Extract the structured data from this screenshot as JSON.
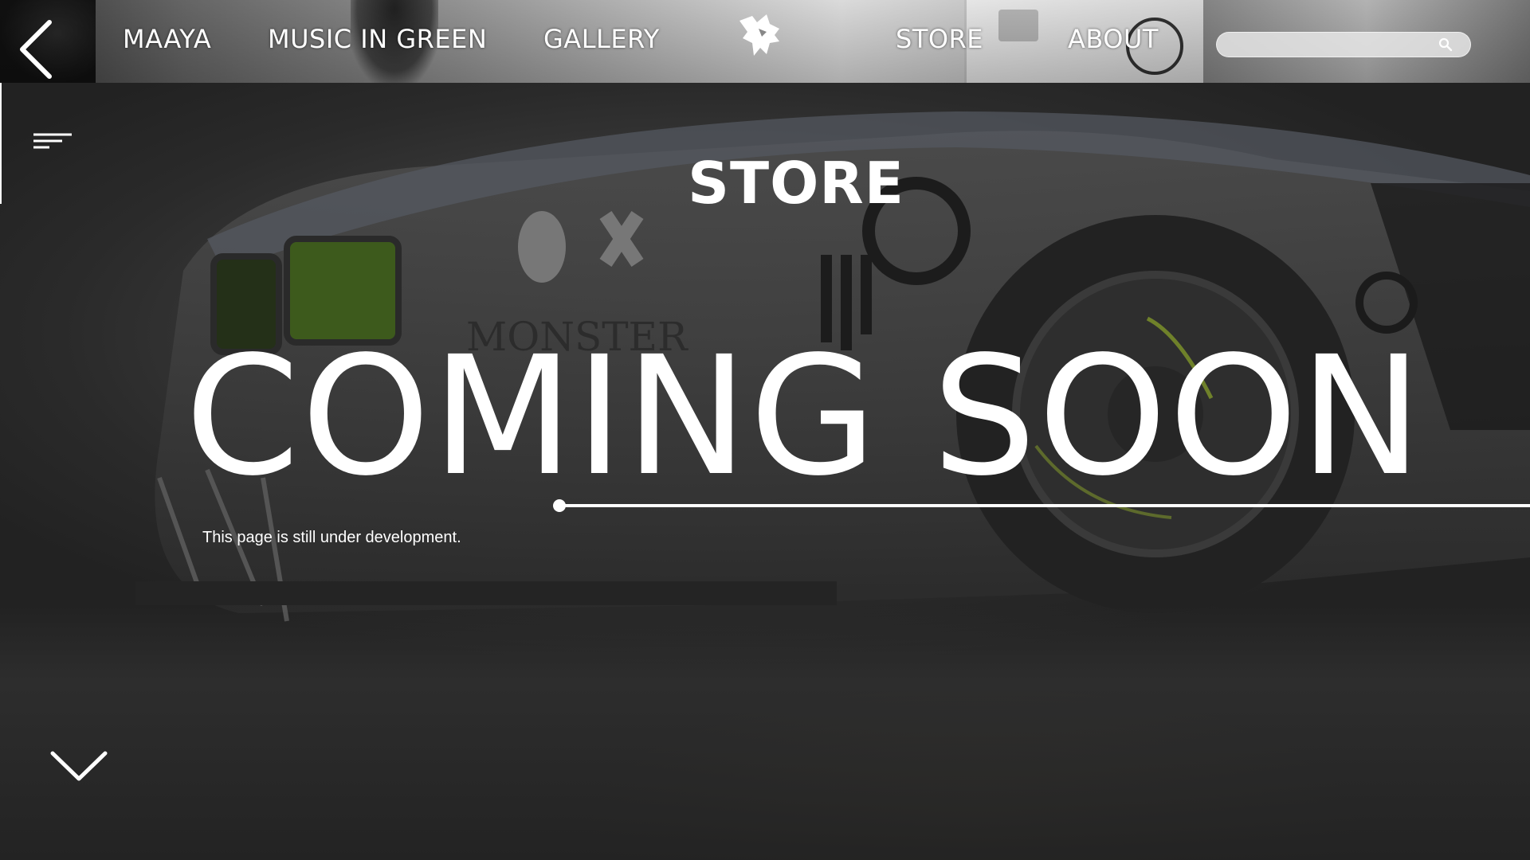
{
  "nav": {
    "items": [
      {
        "label": "MAAYA"
      },
      {
        "label": "MUSIC IN GREEN"
      },
      {
        "label": "GALLERY"
      },
      {
        "label": "STORE"
      },
      {
        "label": "ABOUT"
      }
    ],
    "logo_icon": "wolf-head-icon",
    "back_icon": "chevron-left-icon"
  },
  "search": {
    "value": "",
    "icon": "search-icon"
  },
  "menu": {
    "icon": "menu-lines-icon"
  },
  "main": {
    "heading": "STORE",
    "headline": "COMING SOON",
    "subtext": "This page is still under development."
  },
  "scroll": {
    "icon": "chevron-down-icon"
  },
  "colors": {
    "text": "#ffffff",
    "background": "#2a2a2a"
  }
}
